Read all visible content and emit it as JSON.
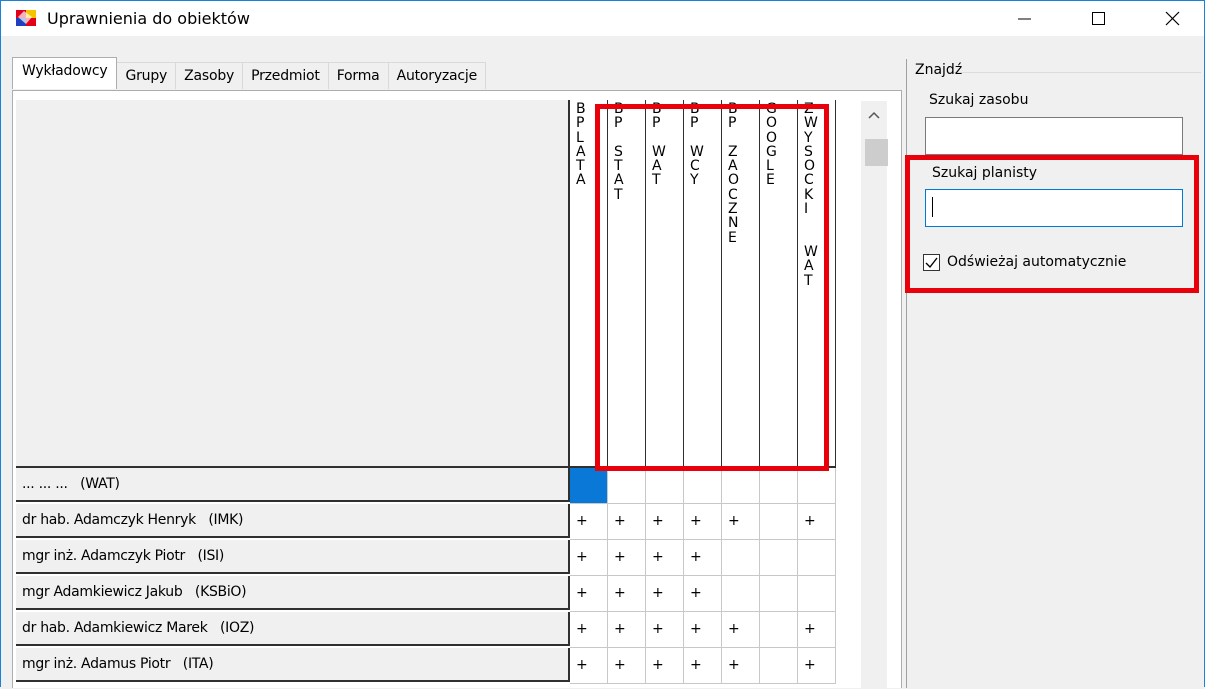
{
  "window": {
    "title": "Uprawnienia do obiektów",
    "controls": {
      "minimize": "—",
      "maximize": "☐",
      "close": "✕"
    }
  },
  "tabs": [
    {
      "label": "Wykładowcy",
      "active": true
    },
    {
      "label": "Grupy",
      "active": false
    },
    {
      "label": "Zasoby",
      "active": false
    },
    {
      "label": "Przedmiot",
      "active": false
    },
    {
      "label": "Forma",
      "active": false
    },
    {
      "label": "Autoryzacje",
      "active": false
    }
  ],
  "grid": {
    "columns": [
      "B\nP\nL\nA\nT\nA",
      "B\nP\n\nS\nT\nA\nT",
      "B\nP\n\nW\nA\nT",
      "B\nP\n\nW\nC\nY",
      "B\nP\n\nZ\nA\nO\nC\nZ\nN\nE",
      "G\nO\nO\nG\nL\nE",
      "Z\nW\nY\nS\nO\nC\nK\nI\n\n\nW\nA\nT"
    ],
    "rows": [
      {
        "name": "... ... ...   (WAT)",
        "cells": [
          "",
          "",
          "",
          "",
          "",
          "",
          ""
        ]
      },
      {
        "name": "dr hab. Adamczyk Henryk   (IMK)",
        "cells": [
          "+",
          "+",
          "+",
          "+",
          "+",
          "",
          "+"
        ]
      },
      {
        "name": "mgr inż. Adamczyk Piotr   (ISI)",
        "cells": [
          "+",
          "+",
          "+",
          "+",
          "",
          "",
          ""
        ]
      },
      {
        "name": "mgr Adamkiewicz Jakub   (KSBiO)",
        "cells": [
          "+",
          "+",
          "+",
          "+",
          "",
          "",
          ""
        ]
      },
      {
        "name": "dr hab. Adamkiewicz Marek   (IOZ)",
        "cells": [
          "+",
          "+",
          "+",
          "+",
          "+",
          "",
          "+"
        ]
      },
      {
        "name": "mgr inż. Adamus Piotr   (ITA)",
        "cells": [
          "+",
          "+",
          "+",
          "+",
          "+",
          "",
          "+"
        ]
      }
    ]
  },
  "find_panel": {
    "group_title": "Znajdź",
    "search_resource_label": "Szukaj zasobu",
    "search_resource_value": "",
    "search_planner_label": "Szukaj planisty",
    "search_planner_value": "",
    "auto_refresh_label": "Odświeżaj automatycznie",
    "auto_refresh_checked": true
  },
  "colors": {
    "highlight": "#e8000b",
    "selection": "#0a78d7",
    "accent": "#0078d7"
  }
}
